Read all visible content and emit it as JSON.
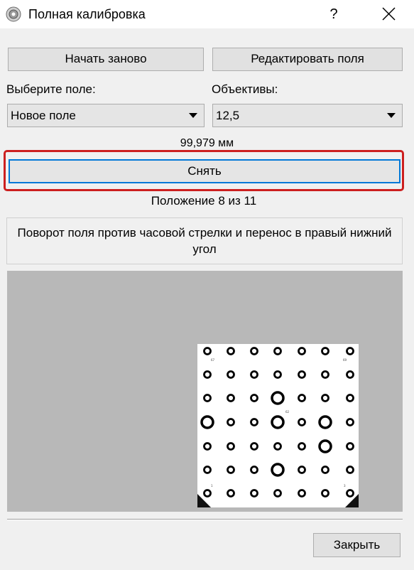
{
  "window": {
    "title": "Полная калибровка",
    "help": "?"
  },
  "toolbar": {
    "restart_label": "Начать заново",
    "edit_fields_label": "Редактировать поля"
  },
  "field_select": {
    "label": "Выберите поле:",
    "value": "Новое поле"
  },
  "lens_select": {
    "label": "Объективы:",
    "value": "12,5"
  },
  "measurement": "99,979 мм",
  "capture_label": "Снять",
  "position_text": "Положение 8 из 11",
  "instruction_text": "Поворот поля против часовой стрелки и перенос в правый нижний угол",
  "footer": {
    "close_label": "Закрыть"
  },
  "colors": {
    "highlight": "#cc1f1f",
    "focus": "#0078d7",
    "preview_bg": "#b8b8b8"
  },
  "icons": {
    "app": "settings-gear-icon",
    "close": "close-x-icon",
    "dropdown": "triangle-down-icon"
  }
}
